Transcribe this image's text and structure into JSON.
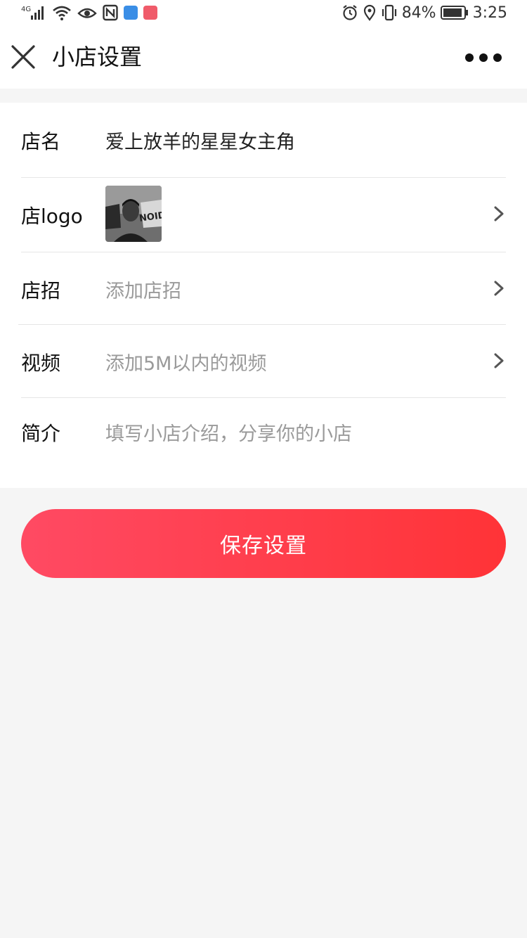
{
  "status_bar": {
    "network": "4G",
    "battery": "84%",
    "time": "3:25"
  },
  "header": {
    "title": "小店设置"
  },
  "form": {
    "rows": [
      {
        "label": "店名",
        "value": "爱上放羊的星星女主角"
      },
      {
        "label": "店logo"
      },
      {
        "label": "店招",
        "placeholder": "添加店招"
      },
      {
        "label": "视频",
        "placeholder": "添加5M以内的视频"
      },
      {
        "label": "简介",
        "placeholder": "填写小店介绍，分享你的小店"
      }
    ]
  },
  "actions": {
    "save_label": "保存设置"
  },
  "colors": {
    "accent_start": "#ff4a63",
    "accent_end": "#ff3337",
    "background": "#f5f5f5",
    "placeholder": "#9a9a9a"
  }
}
